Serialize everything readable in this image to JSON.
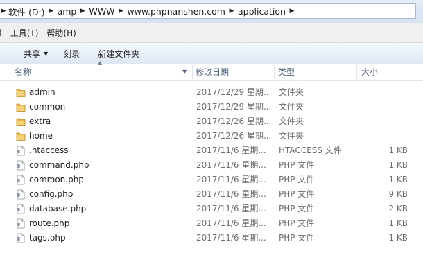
{
  "address": {
    "crumbs": [
      "软件 (D:)",
      "amp",
      "WWW",
      "www.phpnanshen.com",
      "application"
    ]
  },
  "menu": {
    "items": [
      ")",
      "工具(T)",
      "帮助(H)"
    ]
  },
  "toolbar": {
    "share_label": "共享",
    "burn_label": "刻录",
    "newfolder_label": "新建文件夹"
  },
  "columns": {
    "name": "名称",
    "date": "修改日期",
    "type": "类型",
    "size": "大小"
  },
  "files": [
    {
      "name": "admin",
      "date": "2017/12/29 星期...",
      "type": "文件夹",
      "size": "",
      "icon": "folder-icon"
    },
    {
      "name": "common",
      "date": "2017/12/29 星期...",
      "type": "文件夹",
      "size": "",
      "icon": "folder-icon"
    },
    {
      "name": "extra",
      "date": "2017/12/26 星期...",
      "type": "文件夹",
      "size": "",
      "icon": "folder-icon"
    },
    {
      "name": "home",
      "date": "2017/12/26 星期...",
      "type": "文件夹",
      "size": "",
      "icon": "folder-icon"
    },
    {
      "name": ".htaccess",
      "date": "2017/11/6 星期...",
      "type": "HTACCESS 文件",
      "size": "1 KB",
      "icon": "file-icon"
    },
    {
      "name": "command.php",
      "date": "2017/11/6 星期...",
      "type": "PHP 文件",
      "size": "1 KB",
      "icon": "file-icon"
    },
    {
      "name": "common.php",
      "date": "2017/11/6 星期...",
      "type": "PHP 文件",
      "size": "1 KB",
      "icon": "file-icon"
    },
    {
      "name": "config.php",
      "date": "2017/11/6 星期...",
      "type": "PHP 文件",
      "size": "9 KB",
      "icon": "file-icon"
    },
    {
      "name": "database.php",
      "date": "2017/11/6 星期...",
      "type": "PHP 文件",
      "size": "2 KB",
      "icon": "file-icon"
    },
    {
      "name": "route.php",
      "date": "2017/11/6 星期...",
      "type": "PHP 文件",
      "size": "1 KB",
      "icon": "file-icon"
    },
    {
      "name": "tags.php",
      "date": "2017/11/6 星期...",
      "type": "PHP 文件",
      "size": "1 KB",
      "icon": "file-icon"
    }
  ],
  "colors": {
    "folder": "#e8b84a",
    "header_text": "#4c607a",
    "secondary_text": "#6d6d6d"
  }
}
